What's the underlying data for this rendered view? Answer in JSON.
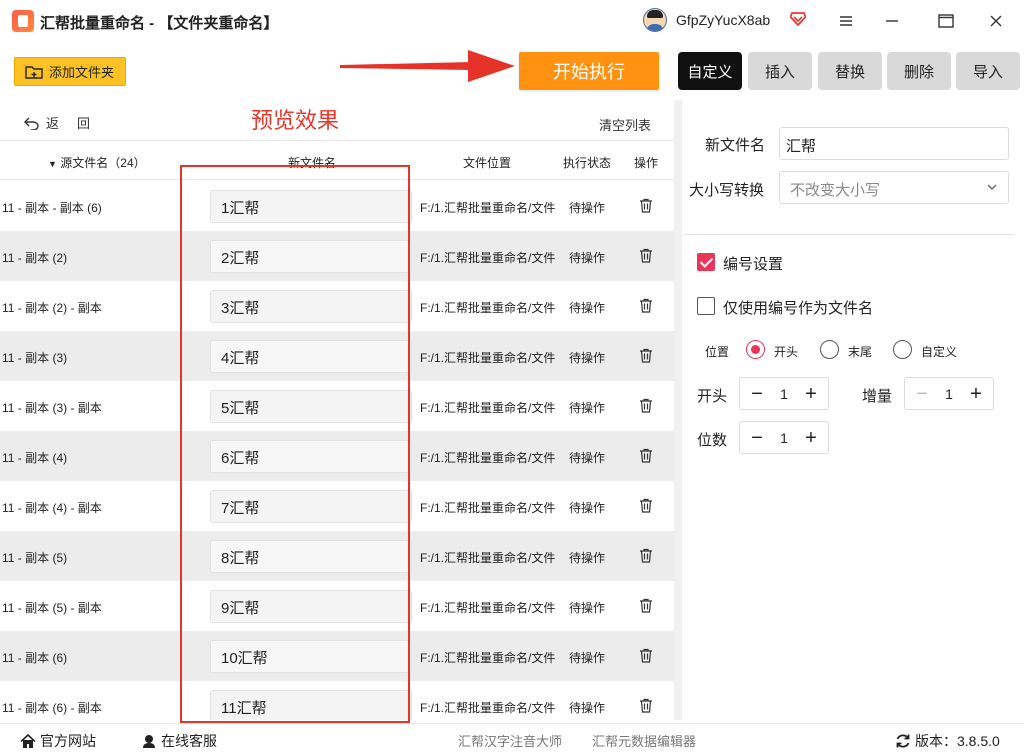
{
  "window": {
    "title": "汇帮批量重命名 - 【文件夹重命名】",
    "username": "GfpZyYucX8ab"
  },
  "toolbar": {
    "add_folder_label": "添加文件夹",
    "start_label": "开始执行"
  },
  "tabs": [
    {
      "label": "自定义",
      "active": true
    },
    {
      "label": "插入",
      "active": false
    },
    {
      "label": "替换",
      "active": false
    },
    {
      "label": "删除",
      "active": false
    },
    {
      "label": "导入",
      "active": false
    }
  ],
  "list": {
    "back_label_1": "返",
    "back_label_2": "回",
    "preview_label": "预览效果",
    "clear_label": "清空列表",
    "columns": {
      "source": "源文件名（24）",
      "new_name": "新文件名",
      "location": "文件位置",
      "status": "执行状态",
      "action": "操作"
    },
    "rows": [
      {
        "source": "11 - 副本 - 副本 (6)",
        "new_name": "1汇帮",
        "location": "F:/1.汇帮批量重命名/文件",
        "status": "待操作"
      },
      {
        "source": "11 - 副本 (2)",
        "new_name": "2汇帮",
        "location": "F:/1.汇帮批量重命名/文件",
        "status": "待操作"
      },
      {
        "source": "11 - 副本 (2) - 副本",
        "new_name": "3汇帮",
        "location": "F:/1.汇帮批量重命名/文件",
        "status": "待操作"
      },
      {
        "source": "11 - 副本 (3)",
        "new_name": "4汇帮",
        "location": "F:/1.汇帮批量重命名/文件",
        "status": "待操作"
      },
      {
        "source": "11 - 副本 (3) - 副本",
        "new_name": "5汇帮",
        "location": "F:/1.汇帮批量重命名/文件",
        "status": "待操作"
      },
      {
        "source": "11 - 副本 (4)",
        "new_name": "6汇帮",
        "location": "F:/1.汇帮批量重命名/文件",
        "status": "待操作"
      },
      {
        "source": "11 - 副本 (4) - 副本",
        "new_name": "7汇帮",
        "location": "F:/1.汇帮批量重命名/文件",
        "status": "待操作"
      },
      {
        "source": "11 - 副本 (5)",
        "new_name": "8汇帮",
        "location": "F:/1.汇帮批量重命名/文件",
        "status": "待操作"
      },
      {
        "source": "11 - 副本 (5) - 副本",
        "new_name": "9汇帮",
        "location": "F:/1.汇帮批量重命名/文件",
        "status": "待操作"
      },
      {
        "source": "11 - 副本 (6)",
        "new_name": "10汇帮",
        "location": "F:/1.汇帮批量重命名/文件",
        "status": "待操作"
      },
      {
        "source": "11 - 副本 (6) - 副本",
        "new_name": "11汇帮",
        "location": "F:/1.汇帮批量重命名/文件",
        "status": "待操作"
      }
    ]
  },
  "settings": {
    "new_name_label": "新文件名",
    "new_name_value": "汇帮",
    "case_label": "大小写转换",
    "case_value": "不改变大小写",
    "numbering_label": "编号设置",
    "numbering_checked": true,
    "only_number_label": "仅使用编号作为文件名",
    "only_number_checked": false,
    "position_label": "位置",
    "position_options": [
      {
        "label": "开头",
        "checked": true
      },
      {
        "label": "末尾",
        "checked": false
      },
      {
        "label": "自定义",
        "checked": false
      }
    ],
    "start_label": "开头",
    "start_value": "1",
    "increment_label": "增量",
    "increment_value": "1",
    "digits_label": "位数",
    "digits_value": "1"
  },
  "footer": {
    "website": "官方网站",
    "support": "在线客服",
    "pinyin_tool": "汇帮汉字注音大师",
    "metadata_tool": "汇帮元数据编辑器",
    "version": "版本：3.8.5.0"
  },
  "colors": {
    "accent": "#e8365a",
    "start_button": "#ff9311",
    "add_button": "#fcc224",
    "annotation_red": "#e5332a"
  }
}
